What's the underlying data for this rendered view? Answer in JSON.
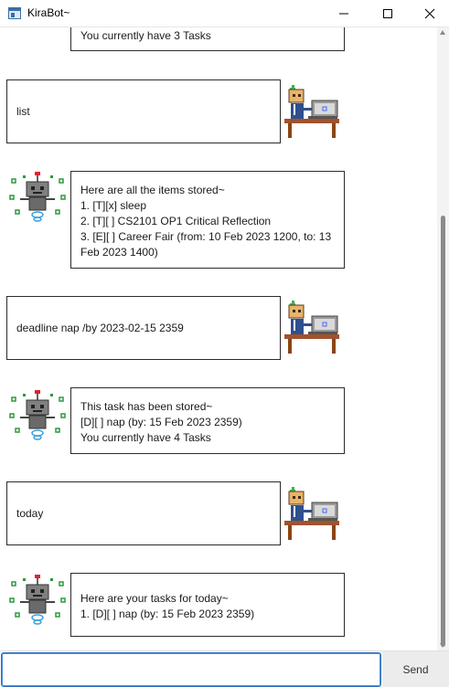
{
  "window": {
    "title": "KiraBot~",
    "minimize_icon": "minimize-icon",
    "maximize_icon": "maximize-icon",
    "close_icon": "close-icon"
  },
  "messages": [
    {
      "sender": "bot",
      "lines": [
        "You currently have 3 Tasks"
      ]
    },
    {
      "sender": "user",
      "lines": [
        "list"
      ]
    },
    {
      "sender": "bot",
      "lines": [
        "Here are all the items stored~",
        "1. [T][x] sleep",
        "2. [T][ ] CS2101 OP1 Critical Reflection",
        "3. [E][ ] Career Fair (from: 10 Feb 2023 1200, to: 13 Feb 2023 1400)"
      ]
    },
    {
      "sender": "user",
      "lines": [
        "deadline nap /by 2023-02-15 2359"
      ]
    },
    {
      "sender": "bot",
      "lines": [
        "This task has been stored~",
        "[D][ ] nap (by: 15 Feb 2023 2359)",
        "You currently have 4 Tasks"
      ]
    },
    {
      "sender": "user",
      "lines": [
        "today"
      ]
    },
    {
      "sender": "bot",
      "lines": [
        "Here are your tasks for today~",
        "1. [D][ ] nap (by: 15 Feb 2023 2359)"
      ]
    }
  ],
  "avatars": {
    "user": "user-at-desk-icon",
    "bot": "robot-icon"
  },
  "input": {
    "value": "",
    "placeholder": ""
  },
  "send_button": {
    "label": "Send"
  },
  "colors": {
    "border": "#2b2b2b",
    "input_focus": "#2c6fbf",
    "send_bg": "#ececec",
    "desk": "#a0522d",
    "robot_body": "#7f7f7f"
  }
}
